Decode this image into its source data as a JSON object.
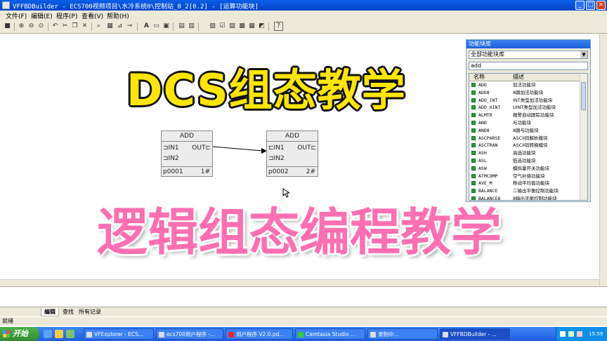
{
  "window": {
    "title": "VFFBDBuilder - ECS700视频项目\\水冷系统0\\控制站_0_2[0.2] - [运算功能块]"
  },
  "menu": [
    "文件(F)",
    "编辑(E)",
    "程序(P)",
    "查看(V)",
    "帮助(H)"
  ],
  "toolbar": {
    "box_label": "A",
    "help_glyph": "?"
  },
  "blocks": [
    {
      "name": "ADD",
      "in1": "IN1",
      "in2": "IN2",
      "out": "OUT",
      "id": "p0001",
      "num": "1#"
    },
    {
      "name": "ADD",
      "in1": "IN1",
      "in2": "IN2",
      "out": "OUT",
      "id": "p0002",
      "num": "2#"
    }
  ],
  "overlay": {
    "title": "DCS组态教学",
    "subtitle": "逻辑组态编程教学"
  },
  "library": {
    "title": "功能块库",
    "category": "全部功能块库",
    "search": "add",
    "col_name": "名称",
    "col_desc": "描述",
    "items": [
      {
        "name": "ADD",
        "desc": "加法功能块"
      },
      {
        "name": "ADD8",
        "desc": "8路加法功能块"
      },
      {
        "name": "ADD_INT",
        "desc": "INT类型加法功能块"
      },
      {
        "name": "ADD_UINT",
        "desc": "UINT类型加法功能块"
      },
      {
        "name": "ALMTR",
        "desc": "报警自动跟踪功能块"
      },
      {
        "name": "AND",
        "desc": "与功能块"
      },
      {
        "name": "AND8",
        "desc": "8路与功能块"
      },
      {
        "name": "ASCPARSE",
        "desc": "ASCII码解析模块"
      },
      {
        "name": "ASCTRAN",
        "desc": "ASCII码转换模块"
      },
      {
        "name": "ASH",
        "desc": "高选功能块"
      },
      {
        "name": "ASL",
        "desc": "低选功能块"
      },
      {
        "name": "ASW",
        "desc": "模拟量开关功能块"
      },
      {
        "name": "ATMCOMP",
        "desc": "空气补偿功能块"
      },
      {
        "name": "AVE_M",
        "desc": "移动平均值功能块"
      },
      {
        "name": "BALANCE",
        "desc": "二输出平衡控制功能块"
      },
      {
        "name": "BALANCE8",
        "desc": "8输出平衡控制功能块"
      }
    ]
  },
  "tabs": [
    "编辑",
    "查找",
    "所有记录"
  ],
  "status": "就绪",
  "taskbar": {
    "start": "开始",
    "tasks": [
      "VFExplorer - ECS...",
      "ecs700用户程序 -...",
      "用户程序 V2.0.pd...",
      "Camtasia Studio ...",
      "录制中...",
      "VFFBDBuilder - ..."
    ],
    "clock": "15:59"
  }
}
